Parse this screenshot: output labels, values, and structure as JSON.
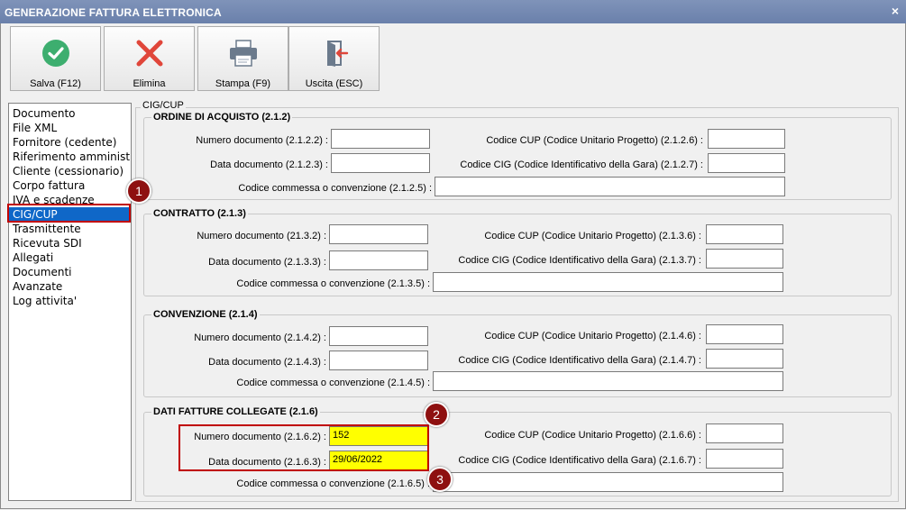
{
  "window": {
    "title": "GENERAZIONE FATTURA ELETTRONICA",
    "close_glyph": "×"
  },
  "toolbar": {
    "save_label": "Salva (F12)",
    "delete_label": "Elimina",
    "print_label": "Stampa (F9)",
    "exit_label": "Uscita (ESC)"
  },
  "sidebar": {
    "items": [
      "Documento",
      "File XML",
      "Fornitore (cedente)",
      "Riferimento amministrativo",
      "Cliente (cessionario)",
      "Corpo fattura",
      "IVA e scadenze",
      "CIG/CUP",
      "Trasmittente",
      "Ricevuta SDI",
      "Allegati",
      "Documenti",
      "Avanzate",
      "Log attivita'"
    ],
    "selected": "CIG/CUP"
  },
  "badges": [
    "1",
    "2",
    "3"
  ],
  "main": {
    "caption": "CIG/CUP",
    "ordine": {
      "title": "ORDINE DI ACQUISTO (2.1.2)",
      "num_label": "Numero documento (2.1.2.2) :",
      "data_label": "Data documento (2.1.2.3) :",
      "cup_label": "Codice CUP (Codice Unitario Progetto) (2.1.2.6) :",
      "cig_label": "Codice CIG (Codice Identificativo della Gara) (2.1.2.7) :",
      "comm_label": "Codice commessa o convenzione (2.1.2.5) :"
    },
    "contratto": {
      "title": "CONTRATTO (2.1.3)",
      "num_label": "Numero documento (21.3.2) :",
      "data_label": "Data documento (2.1.3.3) :",
      "cup_label": "Codice CUP (Codice Unitario Progetto) (2.1.3.6) :",
      "cig_label": "Codice CIG (Codice Identificativo della Gara) (2.1.3.7) :",
      "comm_label": "Codice commessa o convenzione (2.1.3.5) :"
    },
    "convenzione": {
      "title": "CONVENZIONE (2.1.4)",
      "num_label": "Numero documento (2.1.4.2) :",
      "data_label": "Data documento (2.1.4.3) :",
      "cup_label": "Codice CUP (Codice Unitario Progetto) (2.1.4.6) :",
      "cig_label": "Codice CIG (Codice Identificativo della Gara) (2.1.4.7) :",
      "comm_label": "Codice commessa o convenzione (2.1.4.5) :"
    },
    "fatture": {
      "title": "DATI FATTURE COLLEGATE (2.1.6)",
      "num_label": "Numero documento (2.1.6.2) :",
      "num_value": "152",
      "data_label": "Data documento (2.1.6.3) :",
      "data_value": "29/06/2022",
      "cup_label": "Codice CUP (Codice Unitario Progetto) (2.1.6.6) :",
      "cig_label": "Codice CIG (Codice Identificativo della Gara) (2.1.6.7) :",
      "comm_label": "Codice commessa o convenzione (2.1.6.5) :"
    }
  },
  "colors": {
    "accent": "#0f67c8",
    "highlight": "#ffff00",
    "annotation": "#c00000",
    "badge": "#8e1010"
  }
}
